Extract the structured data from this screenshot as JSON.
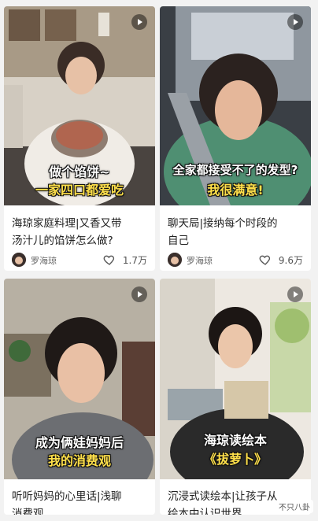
{
  "feed": {
    "cards": [
      {
        "caption_top": "做个馅饼~",
        "caption_bottom": "一家四口都爱吃",
        "title_line1": "海琼家庭料理|又香又带",
        "title_line2": "汤汁儿的馅饼怎么做?",
        "author": "罗海琼",
        "likes": "1.7万"
      },
      {
        "caption_top": "全家都接受不了的发型?",
        "caption_bottom": "我很满意!",
        "title_line1": "聊天局|接纳每个时段的",
        "title_line2": "自己",
        "author": "罗海琼",
        "likes": "9.6万"
      },
      {
        "caption_top": "成为俩娃妈妈后",
        "caption_bottom": "我的消费观",
        "title_line1": "听听妈妈的心里话|浅聊",
        "title_line2": "消费观"
      },
      {
        "caption_top": "海琼读绘本",
        "caption_bottom": "《拔萝卜》",
        "title_line1": "沉浸式读绘本|让孩子从",
        "title_line2": "绘本中认识世界"
      }
    ]
  },
  "watermark": "不只八卦",
  "colors": {
    "caption_yellow": "#ffe04a",
    "card_bg": "#ffffff",
    "page_bg": "#f2f2f2"
  }
}
